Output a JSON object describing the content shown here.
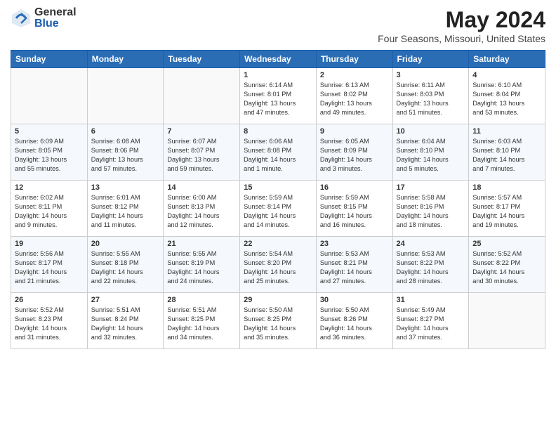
{
  "logo": {
    "general": "General",
    "blue": "Blue"
  },
  "title": "May 2024",
  "subtitle": "Four Seasons, Missouri, United States",
  "weekdays": [
    "Sunday",
    "Monday",
    "Tuesday",
    "Wednesday",
    "Thursday",
    "Friday",
    "Saturday"
  ],
  "weeks": [
    [
      {
        "day": "",
        "info": ""
      },
      {
        "day": "",
        "info": ""
      },
      {
        "day": "",
        "info": ""
      },
      {
        "day": "1",
        "info": "Sunrise: 6:14 AM\nSunset: 8:01 PM\nDaylight: 13 hours\nand 47 minutes."
      },
      {
        "day": "2",
        "info": "Sunrise: 6:13 AM\nSunset: 8:02 PM\nDaylight: 13 hours\nand 49 minutes."
      },
      {
        "day": "3",
        "info": "Sunrise: 6:11 AM\nSunset: 8:03 PM\nDaylight: 13 hours\nand 51 minutes."
      },
      {
        "day": "4",
        "info": "Sunrise: 6:10 AM\nSunset: 8:04 PM\nDaylight: 13 hours\nand 53 minutes."
      }
    ],
    [
      {
        "day": "5",
        "info": "Sunrise: 6:09 AM\nSunset: 8:05 PM\nDaylight: 13 hours\nand 55 minutes."
      },
      {
        "day": "6",
        "info": "Sunrise: 6:08 AM\nSunset: 8:06 PM\nDaylight: 13 hours\nand 57 minutes."
      },
      {
        "day": "7",
        "info": "Sunrise: 6:07 AM\nSunset: 8:07 PM\nDaylight: 13 hours\nand 59 minutes."
      },
      {
        "day": "8",
        "info": "Sunrise: 6:06 AM\nSunset: 8:08 PM\nDaylight: 14 hours\nand 1 minute."
      },
      {
        "day": "9",
        "info": "Sunrise: 6:05 AM\nSunset: 8:09 PM\nDaylight: 14 hours\nand 3 minutes."
      },
      {
        "day": "10",
        "info": "Sunrise: 6:04 AM\nSunset: 8:10 PM\nDaylight: 14 hours\nand 5 minutes."
      },
      {
        "day": "11",
        "info": "Sunrise: 6:03 AM\nSunset: 8:10 PM\nDaylight: 14 hours\nand 7 minutes."
      }
    ],
    [
      {
        "day": "12",
        "info": "Sunrise: 6:02 AM\nSunset: 8:11 PM\nDaylight: 14 hours\nand 9 minutes."
      },
      {
        "day": "13",
        "info": "Sunrise: 6:01 AM\nSunset: 8:12 PM\nDaylight: 14 hours\nand 11 minutes."
      },
      {
        "day": "14",
        "info": "Sunrise: 6:00 AM\nSunset: 8:13 PM\nDaylight: 14 hours\nand 12 minutes."
      },
      {
        "day": "15",
        "info": "Sunrise: 5:59 AM\nSunset: 8:14 PM\nDaylight: 14 hours\nand 14 minutes."
      },
      {
        "day": "16",
        "info": "Sunrise: 5:59 AM\nSunset: 8:15 PM\nDaylight: 14 hours\nand 16 minutes."
      },
      {
        "day": "17",
        "info": "Sunrise: 5:58 AM\nSunset: 8:16 PM\nDaylight: 14 hours\nand 18 minutes."
      },
      {
        "day": "18",
        "info": "Sunrise: 5:57 AM\nSunset: 8:17 PM\nDaylight: 14 hours\nand 19 minutes."
      }
    ],
    [
      {
        "day": "19",
        "info": "Sunrise: 5:56 AM\nSunset: 8:17 PM\nDaylight: 14 hours\nand 21 minutes."
      },
      {
        "day": "20",
        "info": "Sunrise: 5:55 AM\nSunset: 8:18 PM\nDaylight: 14 hours\nand 22 minutes."
      },
      {
        "day": "21",
        "info": "Sunrise: 5:55 AM\nSunset: 8:19 PM\nDaylight: 14 hours\nand 24 minutes."
      },
      {
        "day": "22",
        "info": "Sunrise: 5:54 AM\nSunset: 8:20 PM\nDaylight: 14 hours\nand 25 minutes."
      },
      {
        "day": "23",
        "info": "Sunrise: 5:53 AM\nSunset: 8:21 PM\nDaylight: 14 hours\nand 27 minutes."
      },
      {
        "day": "24",
        "info": "Sunrise: 5:53 AM\nSunset: 8:22 PM\nDaylight: 14 hours\nand 28 minutes."
      },
      {
        "day": "25",
        "info": "Sunrise: 5:52 AM\nSunset: 8:22 PM\nDaylight: 14 hours\nand 30 minutes."
      }
    ],
    [
      {
        "day": "26",
        "info": "Sunrise: 5:52 AM\nSunset: 8:23 PM\nDaylight: 14 hours\nand 31 minutes."
      },
      {
        "day": "27",
        "info": "Sunrise: 5:51 AM\nSunset: 8:24 PM\nDaylight: 14 hours\nand 32 minutes."
      },
      {
        "day": "28",
        "info": "Sunrise: 5:51 AM\nSunset: 8:25 PM\nDaylight: 14 hours\nand 34 minutes."
      },
      {
        "day": "29",
        "info": "Sunrise: 5:50 AM\nSunset: 8:25 PM\nDaylight: 14 hours\nand 35 minutes."
      },
      {
        "day": "30",
        "info": "Sunrise: 5:50 AM\nSunset: 8:26 PM\nDaylight: 14 hours\nand 36 minutes."
      },
      {
        "day": "31",
        "info": "Sunrise: 5:49 AM\nSunset: 8:27 PM\nDaylight: 14 hours\nand 37 minutes."
      },
      {
        "day": "",
        "info": ""
      }
    ]
  ]
}
